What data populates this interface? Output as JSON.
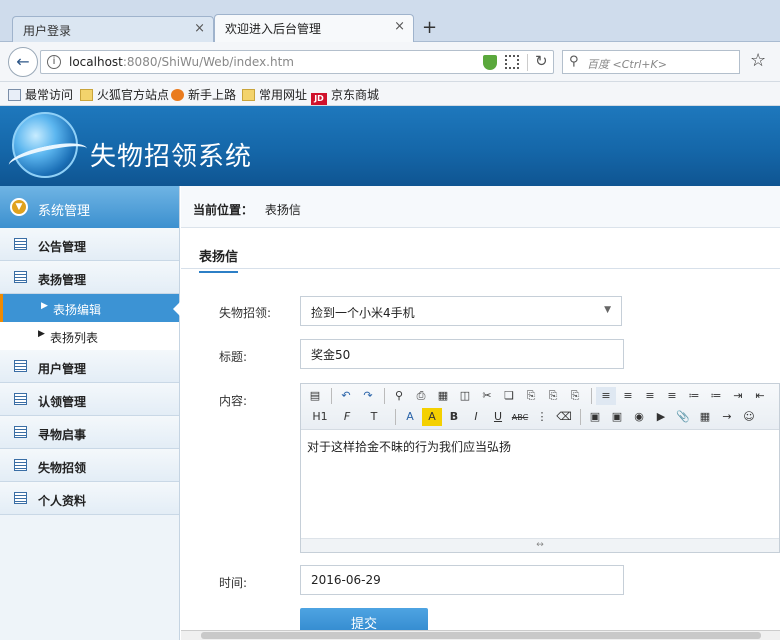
{
  "browser": {
    "tabs": [
      {
        "label": "用户登录",
        "close": "×"
      },
      {
        "label": "欢迎进入后台管理",
        "close": "×"
      }
    ],
    "new_tab": "+",
    "url_host": "localhost",
    "url_rest": ":8080/ShiWu/Web/index.htm",
    "search_placeholder": "百度 <Ctrl+K>",
    "bookmarks": [
      "最常访问",
      "火狐官方站点",
      "新手上路",
      "常用网址",
      "京东商城"
    ],
    "jd_badge": "JD"
  },
  "app": {
    "title": "失物招领系统"
  },
  "sidebar": {
    "header": "系统管理",
    "items": [
      {
        "label": "公告管理"
      },
      {
        "label": "表扬管理",
        "children": [
          {
            "label": "表扬编辑",
            "active": true
          },
          {
            "label": "表扬列表",
            "active": false
          }
        ]
      },
      {
        "label": "用户管理"
      },
      {
        "label": "认领管理"
      },
      {
        "label": "寻物启事"
      },
      {
        "label": "失物招领"
      },
      {
        "label": "个人资料"
      }
    ]
  },
  "breadcrumb": {
    "label": "当前位置：",
    "value": "表扬信"
  },
  "panel": {
    "tab": "表扬信"
  },
  "form": {
    "lost_item_label": "失物招领:",
    "lost_item_value": "捡到一个小米4手机",
    "title_label": "标题:",
    "title_value": "奖金50",
    "content_label": "内容:",
    "content_value": "对于这样拾金不昧的行为我们应当弘扬",
    "time_label": "时间:",
    "time_value": "2016-06-29",
    "submit_label": "提交"
  },
  "editor_toolbar": {
    "row2_labels": [
      "H1",
      "F",
      "T",
      "A",
      "A",
      "B",
      "I",
      "U",
      "ABC"
    ]
  }
}
